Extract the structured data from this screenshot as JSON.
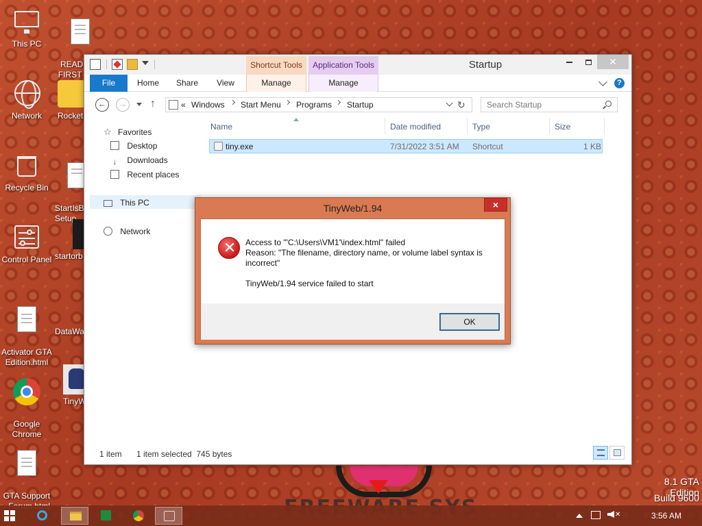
{
  "desktop": {
    "icons": [
      {
        "label": "This PC"
      },
      {
        "label": "README!!\nFIRST FO..."
      },
      {
        "label": "Network"
      },
      {
        "label": "Rocket"
      },
      {
        "label": "Recycle Bin"
      },
      {
        "label": "StartIsBa\nSetup"
      },
      {
        "label": "Control Panel"
      },
      {
        "label": "startorb"
      },
      {
        "label": "Activator GTA\nEdition.html"
      },
      {
        "label": "DataWa"
      },
      {
        "label": "Google\nChrome"
      },
      {
        "label": "TinyW"
      },
      {
        "label": "GTA Support\n- Forum.html"
      }
    ],
    "watermark_edition": "8.1 GTA Edition",
    "watermark_build": "Build 9600",
    "logo_text": "FREEWARE SYS"
  },
  "explorer": {
    "title": "Startup",
    "context_headers": {
      "shortcut_tools": "Shortcut Tools",
      "application_tools": "Application Tools"
    },
    "ribbon_tabs": {
      "file": "File",
      "home": "Home",
      "share": "Share",
      "view": "View",
      "manage_shortcut": "Manage",
      "manage_app": "Manage"
    },
    "help_label": "?",
    "address": {
      "prefix": "«",
      "crumbs": [
        "Windows",
        "Start Menu",
        "Programs",
        "Startup"
      ]
    },
    "search": {
      "placeholder": "Search Startup"
    },
    "nav_pane": {
      "favorites": "Favorites",
      "desktop": "Desktop",
      "downloads": "Downloads",
      "recent_places": "Recent places",
      "this_pc": "This PC",
      "network": "Network"
    },
    "columns": {
      "name": "Name",
      "date_modified": "Date modified",
      "type": "Type",
      "size": "Size"
    },
    "files": [
      {
        "name": "tiny.exe",
        "date_modified": "7/31/2022 3:51 AM",
        "type": "Shortcut",
        "size": "1 KB"
      }
    ],
    "status": {
      "count": "1 item",
      "selected": "1 item selected  745 bytes"
    }
  },
  "dialog": {
    "title": "TinyWeb/1.94",
    "close_label": "×",
    "line1": "Access to \"'C:\\Users\\VM1'\\index.html\" failed",
    "line2": "Reason: \"The filename, directory name, or volume label syntax is incorrect\"",
    "line3": "TinyWeb/1.94 service failed to start",
    "ok_label": "OK"
  },
  "taskbar": {
    "clock": "3:56 AM"
  }
}
